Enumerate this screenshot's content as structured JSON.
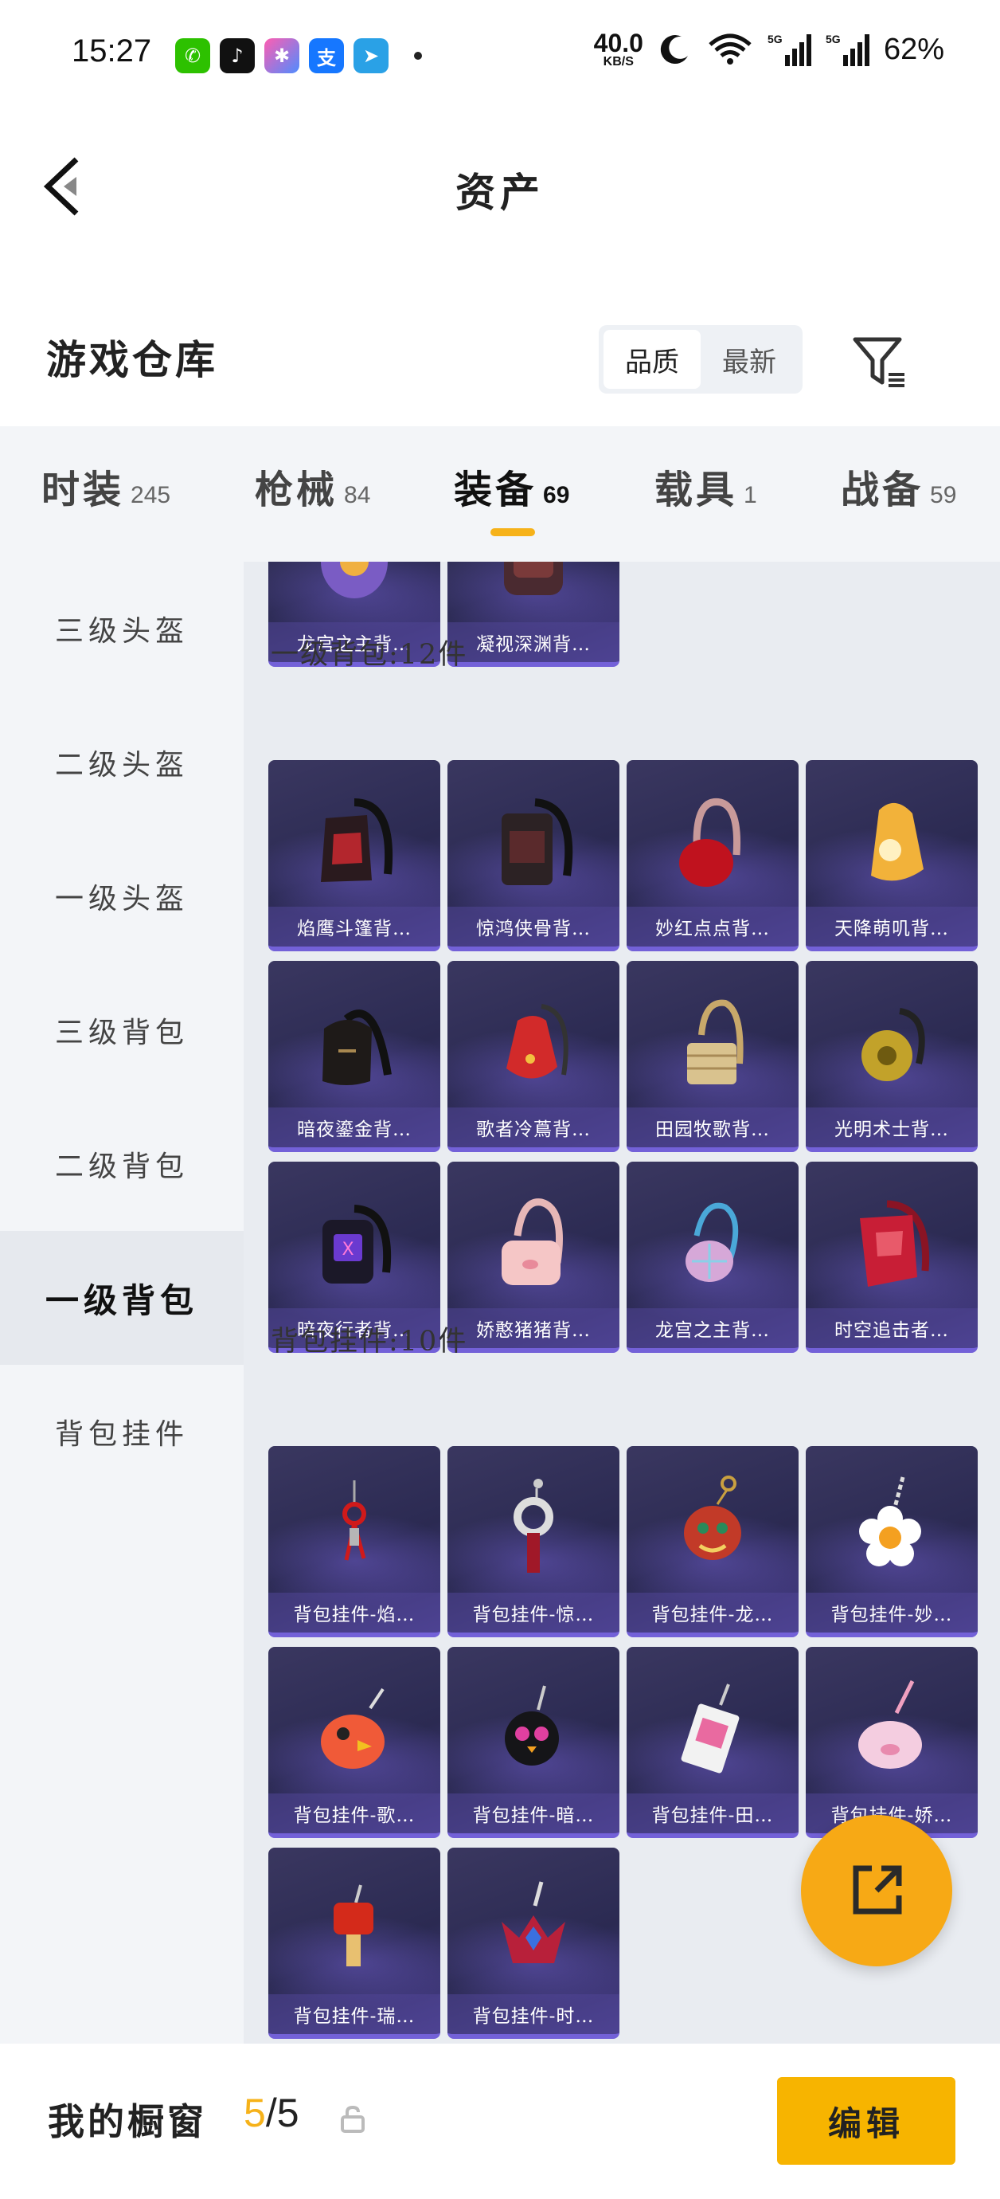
{
  "status_bar": {
    "time": "15:27",
    "app_icons": [
      "wechat-icon",
      "tiktok-icon",
      "star-app-icon",
      "alipay-icon",
      "telegram-icon"
    ],
    "net_speed_value": "40.0",
    "net_speed_unit": "KB/S",
    "signal1_label": "5G",
    "signal2_label": "5G",
    "battery": "62%"
  },
  "header": {
    "title": "资产"
  },
  "section": {
    "title": "游戏仓库",
    "sort_options": [
      "品质",
      "最新"
    ],
    "active_sort": "品质"
  },
  "tabs": [
    {
      "label": "时装",
      "count": "245"
    },
    {
      "label": "枪械",
      "count": "84"
    },
    {
      "label": "装备",
      "count": "69",
      "active": true
    },
    {
      "label": "载具",
      "count": "1"
    },
    {
      "label": "战备",
      "count": "59"
    }
  ],
  "sidebar": {
    "items": [
      {
        "label": "三级头盔"
      },
      {
        "label": "二级头盔"
      },
      {
        "label": "一级头盔"
      },
      {
        "label": "三级背包"
      },
      {
        "label": "二级背包"
      },
      {
        "label": "一级背包",
        "active": true
      },
      {
        "label": "背包挂件"
      }
    ]
  },
  "content": {
    "partial_items": [
      "龙宫之主背…",
      "凝视深渊背…"
    ],
    "group1": {
      "title": "一级背包:12件",
      "items": [
        "焰鹰斗篷背…",
        "惊鸿侠骨背…",
        "妙红点点背…",
        "天降萌叽背…",
        "暗夜鎏金背…",
        "歌者冷蔦背…",
        "田园牧歌背…",
        "光明术士背…",
        "暗夜行者背…",
        "娇憨猪猪背…",
        "龙宫之主背…",
        "时空追击者…"
      ]
    },
    "group2": {
      "title": "背包挂件:10件",
      "items": [
        "背包挂件-焰…",
        "背包挂件-惊…",
        "背包挂件-龙…",
        "背包挂件-妙…",
        "背包挂件-歌…",
        "背包挂件-暗…",
        "背包挂件-田…",
        "背包挂件-娇…",
        "背包挂件-瑞…",
        "背包挂件-时…"
      ]
    }
  },
  "bottom_bar": {
    "label": "我的橱窗",
    "current": "5",
    "separator": "/",
    "total": "5",
    "edit_label": "编辑"
  },
  "colors": {
    "accent": "#f6b21a",
    "card_bg": "#2b2a52",
    "content_bg": "#e9ecf1"
  }
}
